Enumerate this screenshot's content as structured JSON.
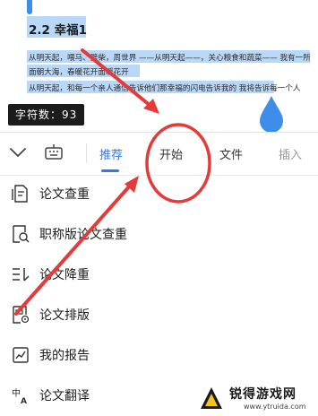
{
  "document": {
    "heading": "2.2  幸福1",
    "lines": [
      "从明天起，喂马、劈柴，周世界 ——从明天起——，关心粮食和蔬菜—— 我有一所",
      "面朝大海，春暖花开面暖花开",
      "从明天起，和每一个亲人通信告诉他们那幸福的闪电告诉我的 我将告诉每一个人"
    ],
    "char_count_label": "字符数：93"
  },
  "toolbar": {
    "tabs": [
      {
        "label": "推荐",
        "active": true
      },
      {
        "label": "开始",
        "active": false
      },
      {
        "label": "文件",
        "active": false
      },
      {
        "label": "插入",
        "active": false
      }
    ]
  },
  "menu": {
    "items": [
      {
        "label": "论文查重",
        "icon": "document-check-icon"
      },
      {
        "label": "职称版论文查重",
        "icon": "magnifier-document-icon"
      },
      {
        "label": "论文降重",
        "icon": "reduce-lines-icon"
      },
      {
        "label": "论文排版",
        "icon": "layout-document-icon"
      },
      {
        "label": "我的报告",
        "icon": "report-chart-icon"
      },
      {
        "label": "论文翻译",
        "icon": "translate-icon"
      }
    ]
  },
  "watermark": {
    "name": "锐得游戏网",
    "url": "www.ytruida.com"
  },
  "colors": {
    "accent": "#2f7ae5",
    "selection": "#b9d7f7",
    "annotation": "#e63a3a"
  }
}
